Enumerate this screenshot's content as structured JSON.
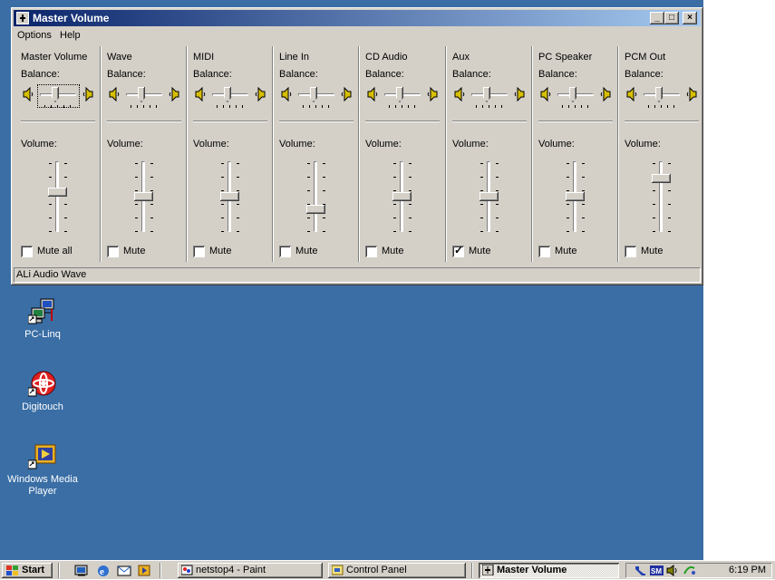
{
  "window": {
    "title": "Master Volume",
    "controls": {
      "minimize": "_",
      "maximize": "□",
      "close": "×"
    },
    "menu": [
      {
        "label": "Options",
        "accel": "p"
      },
      {
        "label": "Help",
        "accel": "H"
      }
    ],
    "status": "ALi Audio Wave"
  },
  "balance_label": "Balance:",
  "volume_label": "Volume:",
  "channels": [
    {
      "name": "Master Volume",
      "mute_label": "Mute all",
      "muted": false,
      "volume": 0.58,
      "focused": true
    },
    {
      "name": "Wave",
      "mute_label": "Mute",
      "muted": false,
      "volume": 0.5,
      "focused": false
    },
    {
      "name": "MIDI",
      "mute_label": "Mute",
      "muted": false,
      "volume": 0.5,
      "focused": false
    },
    {
      "name": "Line In",
      "mute_label": "Mute",
      "muted": false,
      "volume": 0.3,
      "focused": false
    },
    {
      "name": "CD Audio",
      "mute_label": "Mute",
      "muted": false,
      "volume": 0.5,
      "focused": false
    },
    {
      "name": "Aux",
      "mute_label": "Mute",
      "muted": true,
      "volume": 0.5,
      "focused": false
    },
    {
      "name": "PC Speaker",
      "mute_label": "Mute",
      "muted": false,
      "volume": 0.5,
      "focused": false
    },
    {
      "name": "PCM Out",
      "mute_label": "Mute",
      "muted": false,
      "volume": 0.8,
      "focused": false
    }
  ],
  "desktop_icons": [
    {
      "label": "PC-Linq",
      "icon": "network-computer-icon"
    },
    {
      "label": "Digitouch",
      "icon": "digitouch-icon"
    },
    {
      "label": "Windows Media Player",
      "icon": "media-player-icon"
    }
  ],
  "taskbar": {
    "start": "Start",
    "buttons": [
      {
        "label": "netstop4 - Paint",
        "icon": "paint-icon",
        "active": false
      },
      {
        "label": "Control Panel",
        "icon": "control-panel-icon",
        "active": false
      },
      {
        "label": "Master Volume",
        "icon": "volume-icon",
        "active": true
      }
    ],
    "clock": "6:19 PM"
  },
  "colors": {
    "desktop": "#3a6ea5",
    "face": "#d4d0c8",
    "title_start": "#0a246a",
    "title_end": "#a6caf0"
  }
}
